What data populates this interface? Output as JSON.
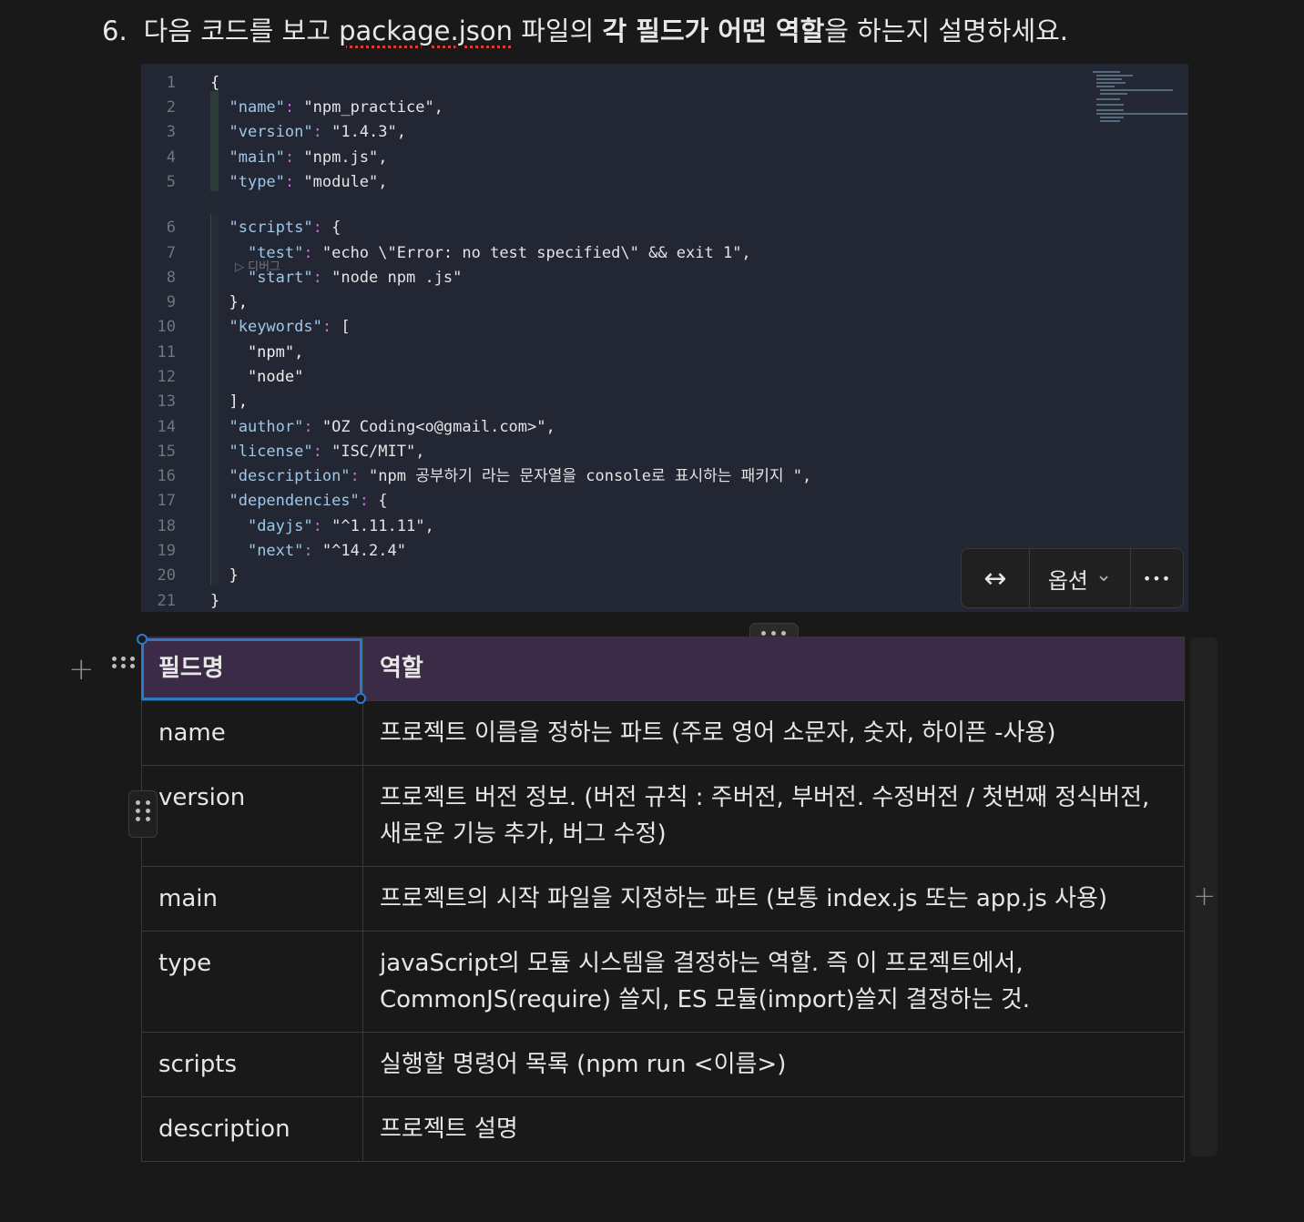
{
  "heading": {
    "number": "6.",
    "pre": "다음 코드를 보고",
    "spell_word": "package.json",
    "mid": "파일의",
    "bold": "각 필드가 어떤 역할",
    "post": "을 하는지 설명하세요."
  },
  "code": {
    "codelens": "▷ 디버그",
    "lines": [
      {
        "n": "1",
        "t": "{"
      },
      {
        "n": "2",
        "t": "  \"name\": \"npm_practice\","
      },
      {
        "n": "3",
        "t": "  \"version\": \"1.4.3\","
      },
      {
        "n": "4",
        "t": "  \"main\": \"npm.js\","
      },
      {
        "n": "5",
        "t": "  \"type\": \"module\","
      },
      {
        "n": "6",
        "t": "  \"scripts\": {"
      },
      {
        "n": "7",
        "t": "    \"test\": \"echo \\\"Error: no test specified\\\" && exit 1\","
      },
      {
        "n": "8",
        "t": "    \"start\": \"node npm .js\""
      },
      {
        "n": "9",
        "t": "  },"
      },
      {
        "n": "10",
        "t": "  \"keywords\": ["
      },
      {
        "n": "11",
        "t": "    \"npm\","
      },
      {
        "n": "12",
        "t": "    \"node\""
      },
      {
        "n": "13",
        "t": "  ],"
      },
      {
        "n": "14",
        "t": "  \"author\": \"OZ Coding<o@gmail.com>\","
      },
      {
        "n": "15",
        "t": "  \"license\": \"ISC/MIT\","
      },
      {
        "n": "16",
        "t": "  \"description\": \"npm 공부하기 라는 문자열을 console로 표시하는 패키지 \","
      },
      {
        "n": "17",
        "t": "  \"dependencies\": {"
      },
      {
        "n": "18",
        "t": "    \"dayjs\": \"^1.11.11\","
      },
      {
        "n": "19",
        "t": "    \"next\": \"^14.2.4\""
      },
      {
        "n": "20",
        "t": "  }"
      },
      {
        "n": "21",
        "t": "}"
      }
    ]
  },
  "toolbar": {
    "wrap_icon": "↔",
    "options_label": "옵션",
    "chevron_icon": "⌄",
    "more_icon": "•••"
  },
  "table": {
    "headers": [
      "필드명",
      "역할"
    ],
    "rows": [
      [
        "name",
        "프로젝트 이름을 정하는 파트 (주로 영어 소문자, 숫자, 하이픈 -사용)"
      ],
      [
        "version",
        "프로젝트 버전 정보. (버전 규칙 : 주버전, 부버전. 수정버전 / 첫번째 정식버전, 새로운 기능 추가, 버그 수정)"
      ],
      [
        "main",
        "프로젝트의 시작 파일을 지정하는 파트 (보통 index.js 또는 app.js 사용)"
      ],
      [
        "type",
        "javaScript의 모듈 시스템을 결정하는 역할. 즉 이 프로젝트에서, CommonJS(require) 쓸지, ES 모듈(import)쓸지 결정하는 것."
      ],
      [
        "scripts",
        "실행할 명령어 목록 (npm run <이름>)"
      ],
      [
        "description",
        "프로젝트 설명"
      ]
    ]
  },
  "icons": {
    "plus": "+",
    "add_column": "+"
  }
}
